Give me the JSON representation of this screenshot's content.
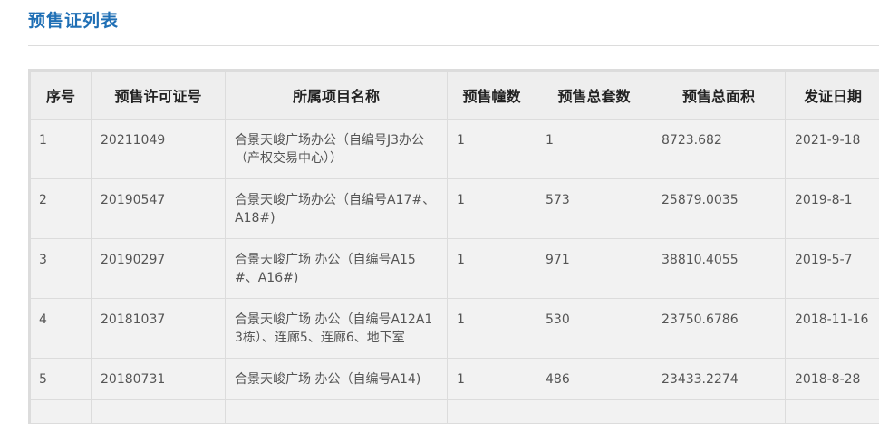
{
  "page": {
    "title": "预售证列表"
  },
  "table": {
    "headers": [
      "序号",
      "预售许可证号",
      "所属项目名称",
      "预售幢数",
      "预售总套数",
      "预售总面积",
      "发证日期"
    ],
    "rows": [
      [
        "1",
        "20211049",
        "合景天峻广场办公（自编号J3办公（产权交易中心））",
        "1",
        "1",
        "8723.682",
        "2021-9-18"
      ],
      [
        "2",
        "20190547",
        "合景天峻广场办公（自编号A17#、A18#)",
        "1",
        "573",
        "25879.0035",
        "2019-8-1"
      ],
      [
        "3",
        "20190297",
        "合景天峻广场 办公（自编号A15#、A16#)",
        "1",
        "971",
        "38810.4055",
        "2019-5-7"
      ],
      [
        "4",
        "20181037",
        "合景天峻广场 办公（自编号A12A13栋）、连廊5、连廊6、地下室",
        "1",
        "530",
        "23750.6786",
        "2018-11-16"
      ],
      [
        "5",
        "20180731",
        "合景天峻广场 办公（自编号A14)",
        "1",
        "486",
        "23433.2274",
        "2018-8-28"
      ]
    ]
  }
}
